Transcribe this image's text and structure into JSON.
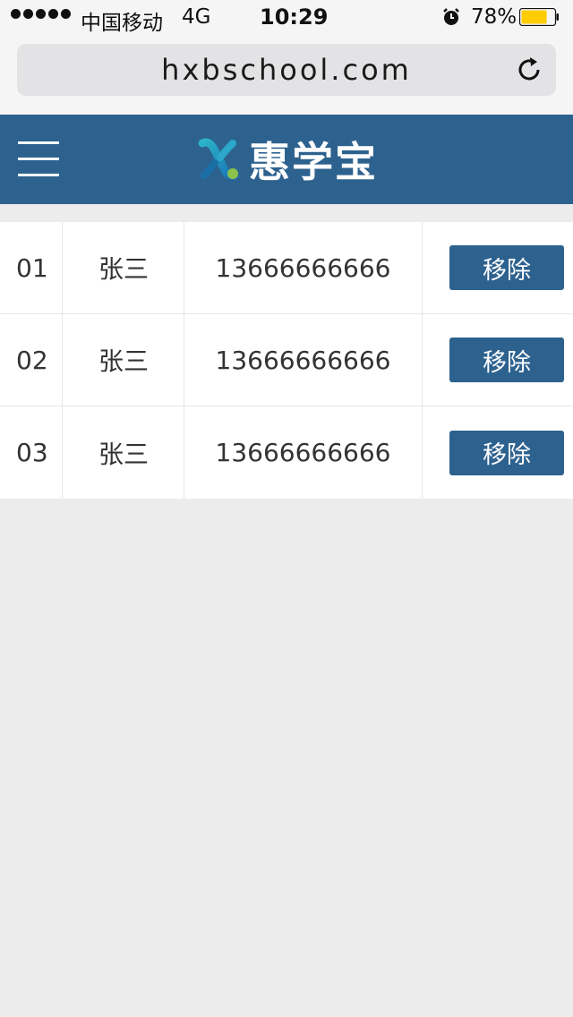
{
  "status_bar": {
    "carrier": "中国移动",
    "network": "4G",
    "time": "10:29",
    "battery_percent": "78%",
    "battery_level": 0.78,
    "battery_color": "#ffcc00",
    "alarm_icon": "alarm-clock-icon"
  },
  "browser": {
    "url": "hxbschool.com",
    "reload_icon": "reload-icon"
  },
  "header": {
    "menu_icon": "hamburger-menu-icon",
    "brand": "惠学宝",
    "background": "#2d628f"
  },
  "rows": [
    {
      "index": "01",
      "name": "张三",
      "phone": "13666666666",
      "action": "移除"
    },
    {
      "index": "02",
      "name": "张三",
      "phone": "13666666666",
      "action": "移除"
    },
    {
      "index": "03",
      "name": "张三",
      "phone": "13666666666",
      "action": "移除"
    }
  ]
}
